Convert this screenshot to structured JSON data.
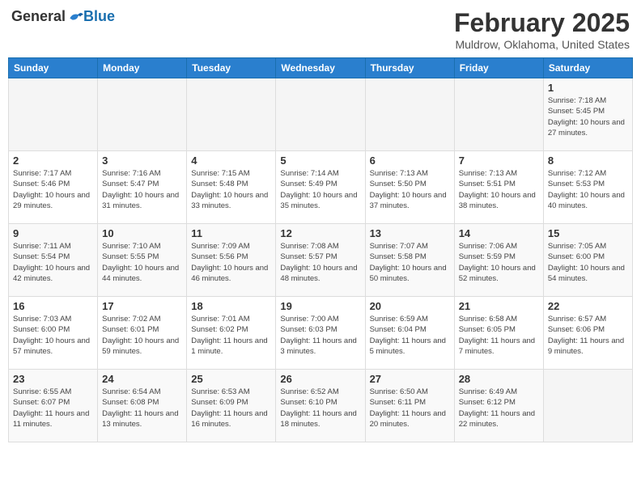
{
  "header": {
    "logo_general": "General",
    "logo_blue": "Blue",
    "month_title": "February 2025",
    "location": "Muldrow, Oklahoma, United States"
  },
  "calendar": {
    "days_of_week": [
      "Sunday",
      "Monday",
      "Tuesday",
      "Wednesday",
      "Thursday",
      "Friday",
      "Saturday"
    ],
    "weeks": [
      [
        {
          "day": "",
          "info": ""
        },
        {
          "day": "",
          "info": ""
        },
        {
          "day": "",
          "info": ""
        },
        {
          "day": "",
          "info": ""
        },
        {
          "day": "",
          "info": ""
        },
        {
          "day": "",
          "info": ""
        },
        {
          "day": "1",
          "info": "Sunrise: 7:18 AM\nSunset: 5:45 PM\nDaylight: 10 hours and 27 minutes."
        }
      ],
      [
        {
          "day": "2",
          "info": "Sunrise: 7:17 AM\nSunset: 5:46 PM\nDaylight: 10 hours and 29 minutes."
        },
        {
          "day": "3",
          "info": "Sunrise: 7:16 AM\nSunset: 5:47 PM\nDaylight: 10 hours and 31 minutes."
        },
        {
          "day": "4",
          "info": "Sunrise: 7:15 AM\nSunset: 5:48 PM\nDaylight: 10 hours and 33 minutes."
        },
        {
          "day": "5",
          "info": "Sunrise: 7:14 AM\nSunset: 5:49 PM\nDaylight: 10 hours and 35 minutes."
        },
        {
          "day": "6",
          "info": "Sunrise: 7:13 AM\nSunset: 5:50 PM\nDaylight: 10 hours and 37 minutes."
        },
        {
          "day": "7",
          "info": "Sunrise: 7:13 AM\nSunset: 5:51 PM\nDaylight: 10 hours and 38 minutes."
        },
        {
          "day": "8",
          "info": "Sunrise: 7:12 AM\nSunset: 5:53 PM\nDaylight: 10 hours and 40 minutes."
        }
      ],
      [
        {
          "day": "9",
          "info": "Sunrise: 7:11 AM\nSunset: 5:54 PM\nDaylight: 10 hours and 42 minutes."
        },
        {
          "day": "10",
          "info": "Sunrise: 7:10 AM\nSunset: 5:55 PM\nDaylight: 10 hours and 44 minutes."
        },
        {
          "day": "11",
          "info": "Sunrise: 7:09 AM\nSunset: 5:56 PM\nDaylight: 10 hours and 46 minutes."
        },
        {
          "day": "12",
          "info": "Sunrise: 7:08 AM\nSunset: 5:57 PM\nDaylight: 10 hours and 48 minutes."
        },
        {
          "day": "13",
          "info": "Sunrise: 7:07 AM\nSunset: 5:58 PM\nDaylight: 10 hours and 50 minutes."
        },
        {
          "day": "14",
          "info": "Sunrise: 7:06 AM\nSunset: 5:59 PM\nDaylight: 10 hours and 52 minutes."
        },
        {
          "day": "15",
          "info": "Sunrise: 7:05 AM\nSunset: 6:00 PM\nDaylight: 10 hours and 54 minutes."
        }
      ],
      [
        {
          "day": "16",
          "info": "Sunrise: 7:03 AM\nSunset: 6:00 PM\nDaylight: 10 hours and 57 minutes."
        },
        {
          "day": "17",
          "info": "Sunrise: 7:02 AM\nSunset: 6:01 PM\nDaylight: 10 hours and 59 minutes."
        },
        {
          "day": "18",
          "info": "Sunrise: 7:01 AM\nSunset: 6:02 PM\nDaylight: 11 hours and 1 minute."
        },
        {
          "day": "19",
          "info": "Sunrise: 7:00 AM\nSunset: 6:03 PM\nDaylight: 11 hours and 3 minutes."
        },
        {
          "day": "20",
          "info": "Sunrise: 6:59 AM\nSunset: 6:04 PM\nDaylight: 11 hours and 5 minutes."
        },
        {
          "day": "21",
          "info": "Sunrise: 6:58 AM\nSunset: 6:05 PM\nDaylight: 11 hours and 7 minutes."
        },
        {
          "day": "22",
          "info": "Sunrise: 6:57 AM\nSunset: 6:06 PM\nDaylight: 11 hours and 9 minutes."
        }
      ],
      [
        {
          "day": "23",
          "info": "Sunrise: 6:55 AM\nSunset: 6:07 PM\nDaylight: 11 hours and 11 minutes."
        },
        {
          "day": "24",
          "info": "Sunrise: 6:54 AM\nSunset: 6:08 PM\nDaylight: 11 hours and 13 minutes."
        },
        {
          "day": "25",
          "info": "Sunrise: 6:53 AM\nSunset: 6:09 PM\nDaylight: 11 hours and 16 minutes."
        },
        {
          "day": "26",
          "info": "Sunrise: 6:52 AM\nSunset: 6:10 PM\nDaylight: 11 hours and 18 minutes."
        },
        {
          "day": "27",
          "info": "Sunrise: 6:50 AM\nSunset: 6:11 PM\nDaylight: 11 hours and 20 minutes."
        },
        {
          "day": "28",
          "info": "Sunrise: 6:49 AM\nSunset: 6:12 PM\nDaylight: 11 hours and 22 minutes."
        },
        {
          "day": "",
          "info": ""
        }
      ]
    ]
  }
}
